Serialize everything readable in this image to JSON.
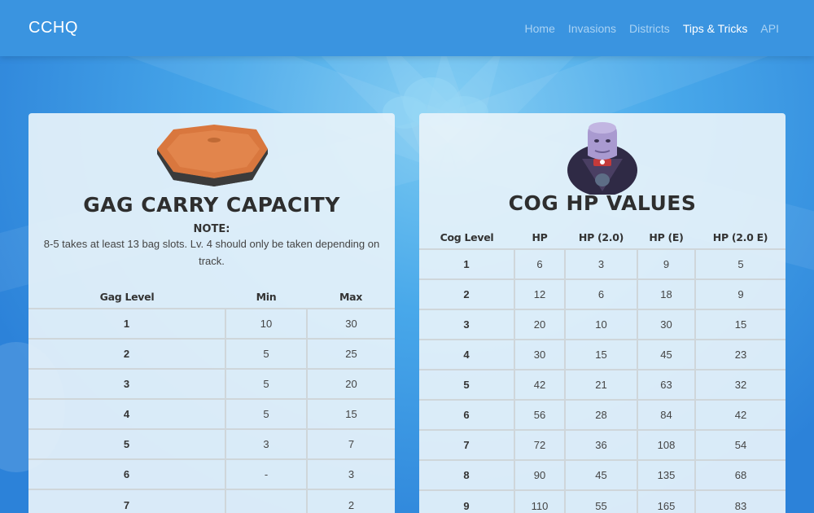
{
  "navbar": {
    "brand": "CCHQ",
    "links": [
      "Home",
      "Invasions",
      "Districts",
      "Tips & Tricks",
      "API"
    ],
    "active": "Tips & Tricks"
  },
  "gag_card": {
    "title": "GAG CARRY CAPACITY",
    "note_label": "NOTE:",
    "note_text": "8-5 takes at least 13 bag slots. Lv. 4 should only be taken depending on track.",
    "columns": [
      "Gag Level",
      "Min",
      "Max"
    ],
    "rows": [
      [
        "1",
        "10",
        "30"
      ],
      [
        "2",
        "5",
        "25"
      ],
      [
        "3",
        "5",
        "20"
      ],
      [
        "4",
        "5",
        "15"
      ],
      [
        "5",
        "3",
        "7"
      ],
      [
        "6",
        "-",
        "3"
      ],
      [
        "7",
        "",
        "2"
      ]
    ]
  },
  "cog_card": {
    "title": "COG HP VALUES",
    "columns": [
      "Cog Level",
      "HP",
      "HP (2.0)",
      "HP (E)",
      "HP (2.0 E)"
    ],
    "rows": [
      [
        "1",
        "6",
        "3",
        "9",
        "5"
      ],
      [
        "2",
        "12",
        "6",
        "18",
        "9"
      ],
      [
        "3",
        "20",
        "10",
        "30",
        "15"
      ],
      [
        "4",
        "30",
        "15",
        "45",
        "23"
      ],
      [
        "5",
        "42",
        "21",
        "63",
        "32"
      ],
      [
        "6",
        "56",
        "28",
        "84",
        "42"
      ],
      [
        "7",
        "72",
        "36",
        "108",
        "54"
      ],
      [
        "8",
        "90",
        "45",
        "135",
        "68"
      ],
      [
        "9",
        "110",
        "55",
        "165",
        "83"
      ]
    ]
  },
  "colors": {
    "navbar": "#3a94e0",
    "nav_link": "#a9d2f3",
    "nav_active": "#ffffff",
    "pie": "#d9773e",
    "cog_head": "#a99ad0",
    "cog_body": "#2f2a45"
  },
  "icons": [
    "cream-pie-icon",
    "cog-portrait-icon"
  ]
}
